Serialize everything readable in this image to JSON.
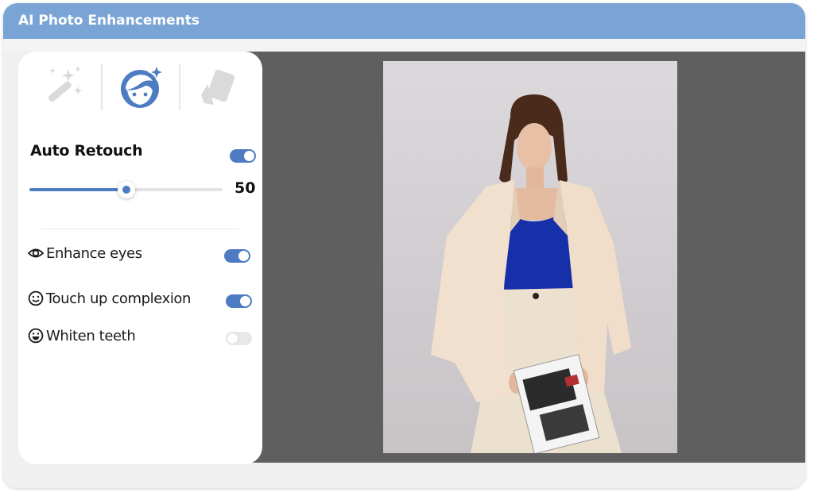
{
  "window": {
    "title": "AI Photo Enhancements"
  },
  "tools": [
    {
      "icon": "magic-wand-icon"
    },
    {
      "icon": "face-sparkle-icon",
      "active": true
    },
    {
      "icon": "cards-icon"
    }
  ],
  "retouch": {
    "label": "Auto Retouch",
    "enabled": true,
    "value": "50",
    "level": 0.5
  },
  "options": [
    {
      "label": "Enhance eyes",
      "icon": "eye-icon",
      "enabled": true
    },
    {
      "label": "Touch up complexion",
      "icon": "smile-icon",
      "enabled": true
    },
    {
      "label": "Whiten teeth",
      "icon": "grin-icon",
      "enabled": false
    }
  ],
  "colors": {
    "accent": "#4d7cc2",
    "titlebar": "#7aa4d6",
    "workspace": "#5f5f5f"
  }
}
